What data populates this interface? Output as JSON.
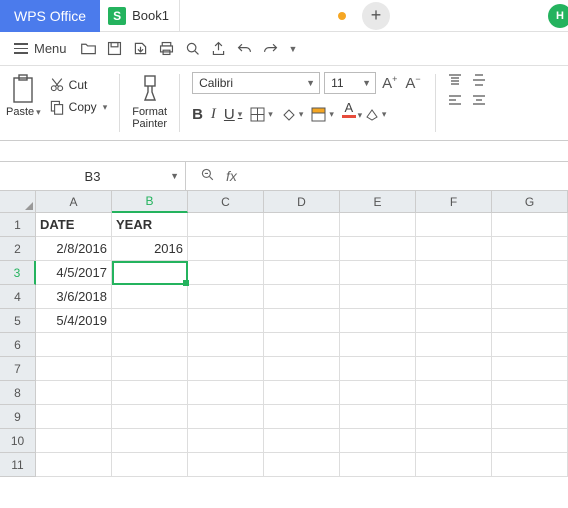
{
  "app": {
    "name": "WPS Office"
  },
  "tab": {
    "icon_letter": "S",
    "title": "Book1"
  },
  "menu": {
    "label": "Menu"
  },
  "ribbon": {
    "paste_label": "Paste",
    "cut_label": "Cut",
    "copy_label": "Copy",
    "format_painter_label": "Format\nPainter",
    "font_name": "Calibri",
    "font_size": "11"
  },
  "namebox": {
    "value": "B3"
  },
  "formula": {
    "value": ""
  },
  "columns": [
    "A",
    "B",
    "C",
    "D",
    "E",
    "F",
    "G"
  ],
  "row_numbers": [
    "1",
    "2",
    "3",
    "4",
    "5",
    "6",
    "7",
    "8",
    "9",
    "10",
    "11"
  ],
  "cells": {
    "A1": "DATE",
    "B1": "YEAR",
    "A2": "2/8/2016",
    "B2": "2016",
    "A3": "4/5/2017",
    "A4": "3/6/2018",
    "A5": "5/4/2019"
  },
  "selected": {
    "col": "B",
    "row": "3"
  }
}
